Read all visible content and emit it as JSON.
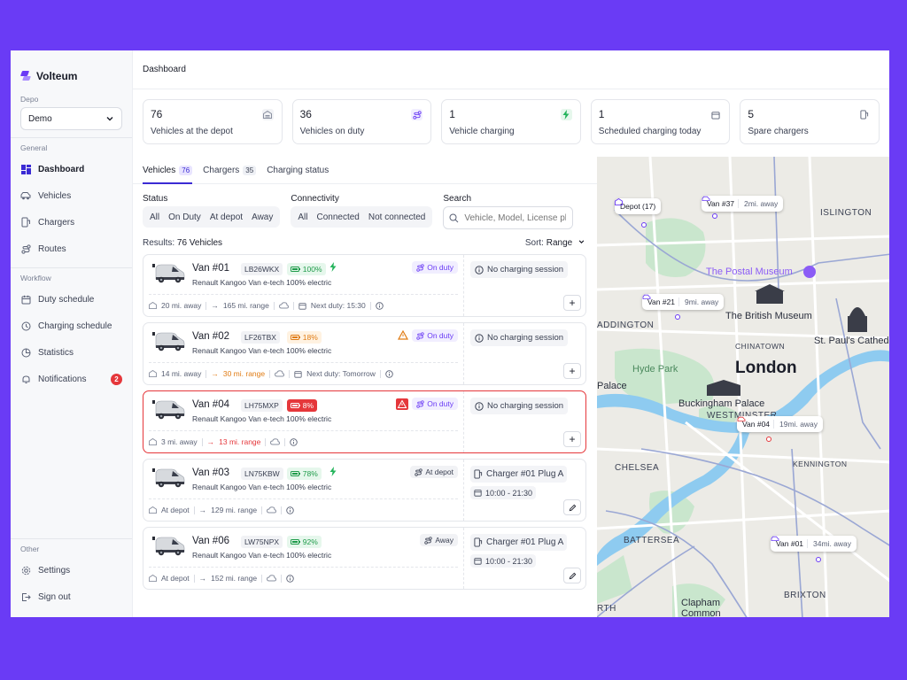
{
  "app": {
    "name": "Volteum",
    "accent": "#6a3bf5"
  },
  "sidebar": {
    "depo_label": "Depo",
    "depo_value": "Demo",
    "general_label": "General",
    "general_items": [
      {
        "label": "Dashboard",
        "icon": "dashboard-icon",
        "active": true
      },
      {
        "label": "Vehicles",
        "icon": "vehicle-icon"
      },
      {
        "label": "Chargers",
        "icon": "charger-icon"
      },
      {
        "label": "Routes",
        "icon": "route-icon"
      }
    ],
    "workflow_label": "Workflow",
    "workflow_items": [
      {
        "label": "Duty schedule",
        "icon": "calendar-icon"
      },
      {
        "label": "Charging schedule",
        "icon": "clock-icon"
      },
      {
        "label": "Statistics",
        "icon": "chart-icon"
      },
      {
        "label": "Notifications",
        "icon": "bell-icon",
        "badge": "2"
      }
    ],
    "other_label": "Other",
    "other_items": [
      {
        "label": "Settings",
        "icon": "gear-icon"
      },
      {
        "label": "Sign out",
        "icon": "sign-out-icon"
      }
    ]
  },
  "header": {
    "title": "Dashboard"
  },
  "stats": [
    {
      "value": "76",
      "label": "Vehicles at the depot",
      "icon": "depot-icon",
      "color": "#8a90a0"
    },
    {
      "value": "36",
      "label": "Vehicles on duty",
      "icon": "route-icon",
      "color": "#6a3bf5"
    },
    {
      "value": "1",
      "label": "Vehicle charging",
      "icon": "bolt-icon",
      "color": "#22b35a"
    },
    {
      "value": "1",
      "label": "Scheduled charging today",
      "icon": "calendar-icon",
      "color": "#5a6175"
    },
    {
      "value": "5",
      "label": "Spare chargers",
      "icon": "charger-icon",
      "color": "#5a6175"
    }
  ],
  "tabs": [
    {
      "label": "Vehicles",
      "count": "76",
      "active": true
    },
    {
      "label": "Chargers",
      "count": "35"
    },
    {
      "label": "Charging status",
      "count": ""
    }
  ],
  "filters": {
    "status_label": "Status",
    "status_options": [
      "All",
      "On Duty",
      "At depot",
      "Away"
    ],
    "connectivity_label": "Connectivity",
    "connectivity_options": [
      "All",
      "Connected",
      "Not connected"
    ],
    "search_label": "Search",
    "search_placeholder": "Vehicle, Model, License plate"
  },
  "results": {
    "label": "Results:",
    "value": "76 Vehicles",
    "sort_label": "Sort:",
    "sort_value": "Range"
  },
  "vehicles": [
    {
      "name": "Van #01",
      "plate": "LB26WKX",
      "battery": "100%",
      "battery_level": "green",
      "charging": true,
      "model": "Renault Kangoo Van e-tech 100% electric",
      "status": "On duty",
      "status_type": "duty",
      "warning": "",
      "distance": "20 mi. away",
      "range": "165 mi. range",
      "range_tone": "",
      "next_duty": "Next duty: 15:30",
      "session": "No charging session",
      "charger": "",
      "time": "",
      "action": "+"
    },
    {
      "name": "Van #02",
      "plate": "LF26TBX",
      "battery": "18%",
      "battery_level": "orange",
      "charging": false,
      "model": "Renault Kangoo Van e-tech 100% electric",
      "status": "On duty",
      "status_type": "duty",
      "warning": "orange",
      "distance": "14 mi. away",
      "range": "30 mi. range",
      "range_tone": "orange",
      "next_duty": "Next duty: Tomorrow",
      "session": "No charging session",
      "charger": "",
      "time": "",
      "action": "+"
    },
    {
      "name": "Van #04",
      "plate": "LH75MXP",
      "battery": "8%",
      "battery_level": "red",
      "charging": false,
      "model": "Renault Kangoo Van e-tech 100% electric",
      "status": "On duty",
      "status_type": "duty",
      "warning": "red",
      "distance": "3 mi. away",
      "range": "13 mi. range",
      "range_tone": "red",
      "next_duty": "",
      "session": "No charging session",
      "charger": "",
      "time": "",
      "action": "+"
    },
    {
      "name": "Van #03",
      "plate": "LN75KBW",
      "battery": "78%",
      "battery_level": "green",
      "charging": true,
      "model": "Renault Kangoo Van e-tech 100% electric",
      "status": "At depot",
      "status_type": "depot",
      "warning": "",
      "distance": "At depot",
      "range": "129 mi. range",
      "range_tone": "",
      "next_duty": "",
      "session": "",
      "charger": "Charger #01 Plug A",
      "time": "10:00 - 21:30",
      "action": "edit"
    },
    {
      "name": "Van #06",
      "plate": "LW75NPX",
      "battery": "92%",
      "battery_level": "green",
      "charging": false,
      "model": "Renault Kangoo Van e-tech 100% electric",
      "status": "Away",
      "status_type": "away",
      "warning": "",
      "distance": "At depot",
      "range": "152 mi. range",
      "range_tone": "",
      "next_duty": "",
      "session": "",
      "charger": "Charger #01 Plug A",
      "time": "10:00 - 21:30",
      "action": "edit"
    }
  ],
  "map": {
    "pins": [
      {
        "label": "Depot (17)",
        "dist": ""
      },
      {
        "label": "Van #37",
        "dist": "2mi. away"
      },
      {
        "label": "Van #21",
        "dist": "9mi. away"
      },
      {
        "label": "Van #04",
        "dist": "19mi. away"
      },
      {
        "label": "Van #01",
        "dist": "34mi. away"
      }
    ],
    "labels": {
      "islington": "ISLINGTON",
      "postal": "The Postal Museum",
      "addington": "ADDINGTON",
      "british": "The British Museum",
      "chinatown": "CHINATOWN",
      "stpauls": "St. Paul's Cathedral",
      "hyde": "Hyde Park",
      "london": "London",
      "palace": "Palace",
      "buckingham": "Buckingham Palace",
      "westminster": "WESTMINSTER",
      "chelsea": "CHELSEA",
      "kennington": "KENNINGTON",
      "battersea": "BATTERSEA",
      "brixton": "BRIXTON",
      "clapham": "Clapham",
      "common": "Common",
      "north": "RTH"
    }
  }
}
